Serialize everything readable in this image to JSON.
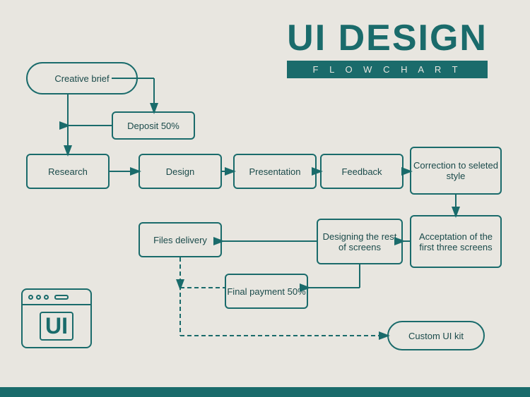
{
  "title": {
    "main": "UI DESIGN",
    "sub": "F L O W C H A R T"
  },
  "boxes": {
    "creative_brief": "Creative brief",
    "deposit": "Deposit 50%",
    "research": "Research",
    "design": "Design",
    "presentation": "Presentation",
    "feedback": "Feedback",
    "correction": "Correction to seleted style",
    "acceptation": "Acceptation of the first three screens",
    "designing_rest": "Designing the rest of screens",
    "files_delivery": "Files delivery",
    "final_payment": "Final payment 50%",
    "custom_ui_kit": "Custom UI kit"
  },
  "colors": {
    "teal": "#1a6b6b",
    "bg": "#e8e6e0",
    "text": "#1a4a4a"
  }
}
